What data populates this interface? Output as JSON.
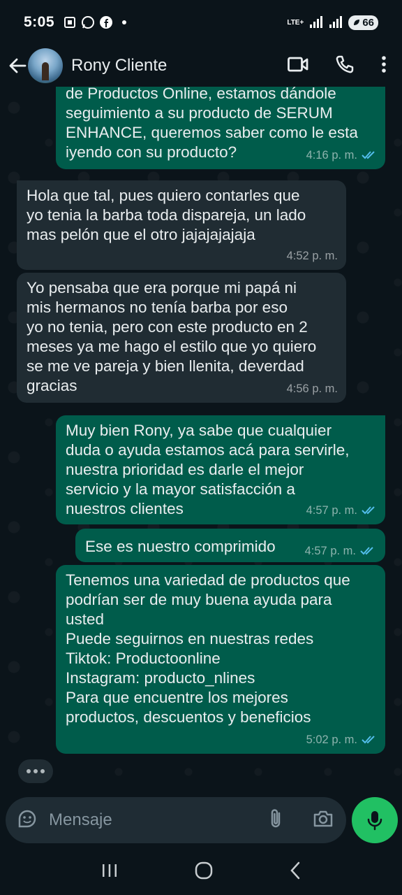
{
  "status_bar": {
    "time": "5:05",
    "network_label": "LTE+",
    "battery_level": "66"
  },
  "header": {
    "contact_name": "Rony Cliente"
  },
  "messages": [
    {
      "direction": "out",
      "text": "de Productos Online, estamos dándole\nseguimiento a su producto de SERUM\nENHANCE, queremos saber como le esta\niyendo con su producto?",
      "time": "4:16 p. m.",
      "read": true
    },
    {
      "direction": "in",
      "text": "Hola que tal, pues quiero contarles que\nyo tenia la barba toda dispareja, un lado\nmas pelón que el otro jajajajajaja",
      "time": "4:52 p. m."
    },
    {
      "direction": "in",
      "text": "Yo pensaba que era porque mi papá ni\nmis hermanos no tenía barba por eso\nyo no tenia, pero con este producto en 2\nmeses ya me hago el estilo que yo quiero\nse me ve pareja y bien llenita, deverdad\ngracias",
      "time": "4:56 p. m."
    },
    {
      "direction": "out",
      "text": "Muy bien Rony, ya sabe que cualquier\nduda o ayuda estamos acá para servirle,\nnuestra prioridad es darle el mejor\nservicio y la mayor satisfacción a\nnuestros clientes",
      "time": "4:57 p. m.",
      "read": true
    },
    {
      "direction": "out",
      "text": "Ese es nuestro comprimido",
      "time": "4:57 p. m.",
      "read": true
    },
    {
      "direction": "out",
      "text": "Tenemos una variedad de productos que\npodrían ser de muy buena ayuda para\nusted\nPuede seguirnos en nuestras redes\nTiktok: Productoonline\nInstagram: producto_nlines\nPara que encuentre los mejores\nproductos, descuentos y beneficios",
      "time": "5:02 p. m.",
      "read": true
    }
  ],
  "composer": {
    "placeholder": "Mensaje"
  },
  "colors": {
    "outgoing_bubble": "#005c4b",
    "incoming_bubble": "#202c33",
    "read_ticks": "#53bdeb",
    "mic_button": "#21c063"
  }
}
